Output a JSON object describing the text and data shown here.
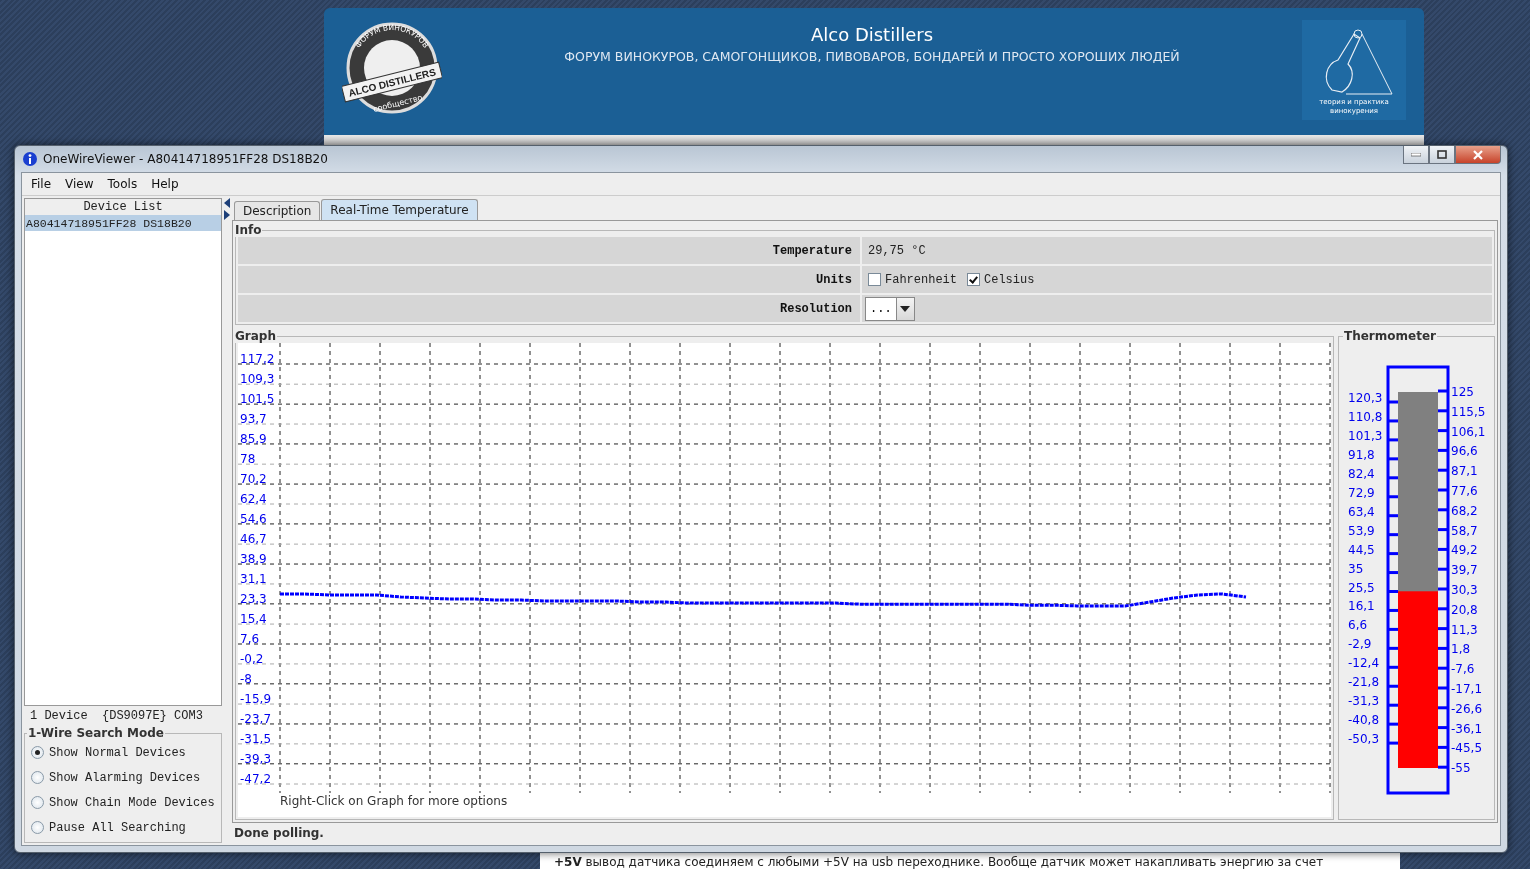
{
  "browser_page": {
    "banner": {
      "title": "Alco Distillers",
      "subtitle": "ФОРУМ ВИНОКУРОВ, САМОГОНЩИКОВ, ПИВОВАРОВ, БОНДАРЕЙ И ПРОСТО ХОРОШИХ ЛЮДЕЙ",
      "logo": {
        "top_text": "ФОРУМ ВИНОКУРОВ",
        "main_text": "ALCO DISTILLERS",
        "bottom_text": "сообщество"
      },
      "emblem": {
        "caption_lines": [
          "теория и практика",
          "винокурения"
        ]
      }
    },
    "post_text": "**+5V** вывод датчика соединяем с любыми +5V на usb переходнике. Вообще датчик может накапливать энергию за счет"
  },
  "window": {
    "title": "OneWireViewer - A80414718951FF28 DS18B20"
  },
  "menu": [
    "File",
    "View",
    "Tools",
    "Help"
  ],
  "device_list": {
    "header": "Device List",
    "items": [
      {
        "label": "A80414718951FF28 DS18B20",
        "selected": true
      }
    ],
    "status": "1 Device  {DS9097E} COM3"
  },
  "search_mode": {
    "title": "1-Wire Search Mode",
    "options": [
      {
        "label": "Show Normal Devices",
        "selected": true
      },
      {
        "label": "Show Alarming Devices",
        "selected": false
      },
      {
        "label": "Show Chain Mode Devices",
        "selected": false
      },
      {
        "label": "Pause All Searching",
        "selected": false
      }
    ]
  },
  "tabs": [
    {
      "label": "Description",
      "selected": false
    },
    {
      "label": "Real-Time Temperature",
      "selected": true
    }
  ],
  "info": {
    "title": "Info",
    "rows": [
      {
        "kind": "text",
        "label": "Temperature",
        "value": "29,75 °C"
      },
      {
        "kind": "checkboxes",
        "label": "Units",
        "options": [
          {
            "label": "Fahrenheit",
            "checked": false
          },
          {
            "label": "Celsius",
            "checked": true
          }
        ]
      },
      {
        "kind": "dropdown",
        "label": "Resolution",
        "value": "..."
      }
    ]
  },
  "graph": {
    "title": "Graph",
    "hint": "Right-Click on Graph for more options",
    "chart_data": {
      "type": "line",
      "ylim": [
        -47.2,
        117.2
      ],
      "grid": true,
      "yticks": [
        {
          "value": 117.2,
          "label": "117,2"
        },
        {
          "value": 109.3,
          "label": "109,3"
        },
        {
          "value": 101.5,
          "label": "101,5"
        },
        {
          "value": 93.7,
          "label": "93,7"
        },
        {
          "value": 85.9,
          "label": "85,9"
        },
        {
          "value": 78,
          "label": "78"
        },
        {
          "value": 70.2,
          "label": "70,2"
        },
        {
          "value": 62.4,
          "label": "62,4"
        },
        {
          "value": 54.6,
          "label": "54,6"
        },
        {
          "value": 46.7,
          "label": "46,7"
        },
        {
          "value": 38.9,
          "label": "38,9"
        },
        {
          "value": 31.1,
          "label": "31,1"
        },
        {
          "value": 23.3,
          "label": "23,3"
        },
        {
          "value": 15.4,
          "label": "15,4"
        },
        {
          "value": 7.6,
          "label": "7,6"
        },
        {
          "value": -0.2,
          "label": "-0,2"
        },
        {
          "value": -8,
          "label": "-8"
        },
        {
          "value": -15.9,
          "label": "-15,9"
        },
        {
          "value": -23.7,
          "label": "-23,7"
        },
        {
          "value": -31.5,
          "label": "-31,5"
        },
        {
          "value": -39.3,
          "label": "-39,3"
        },
        {
          "value": -47.2,
          "label": "-47,2"
        }
      ],
      "series": [
        {
          "color": "#0000ff",
          "line_style": "dotted",
          "values": [
            27.2,
            27.2,
            26.8,
            26.8,
            26.8,
            26.0,
            25.6,
            25.2,
            25.2,
            24.8,
            24.8,
            24.4,
            24.4,
            24.4,
            24.4,
            24.0,
            24.0,
            23.6,
            23.6,
            23.6,
            23.6,
            23.6,
            23.6,
            23.6,
            23.2,
            23.2,
            23.2,
            23.2,
            23.2,
            23.2,
            23.2,
            22.8,
            22.8,
            22.5,
            22.5,
            22.5,
            24.0,
            25.6,
            26.8,
            27.2,
            26.0
          ]
        }
      ]
    }
  },
  "thermometer": {
    "title": "Thermometer",
    "level": 0.47,
    "left_scale": [
      "120,3",
      "110,8",
      "101,3",
      "91,8",
      "82,4",
      "72,9",
      "63,4",
      "53,9",
      "44,5",
      "35",
      "25,5",
      "16,1",
      "6,6",
      "-2,9",
      "-12,4",
      "-21,8",
      "-31,3",
      "-40,8",
      "-50,3"
    ],
    "right_scale": [
      "125",
      "115,5",
      "106,1",
      "96,6",
      "87,1",
      "77,6",
      "68,2",
      "58,7",
      "49,2",
      "39,7",
      "30,3",
      "20,8",
      "11,3",
      "1,8",
      "-7,6",
      "-17,1",
      "-26,6",
      "-36,1",
      "-45,5",
      "-55"
    ]
  },
  "status_bar": "Done polling."
}
